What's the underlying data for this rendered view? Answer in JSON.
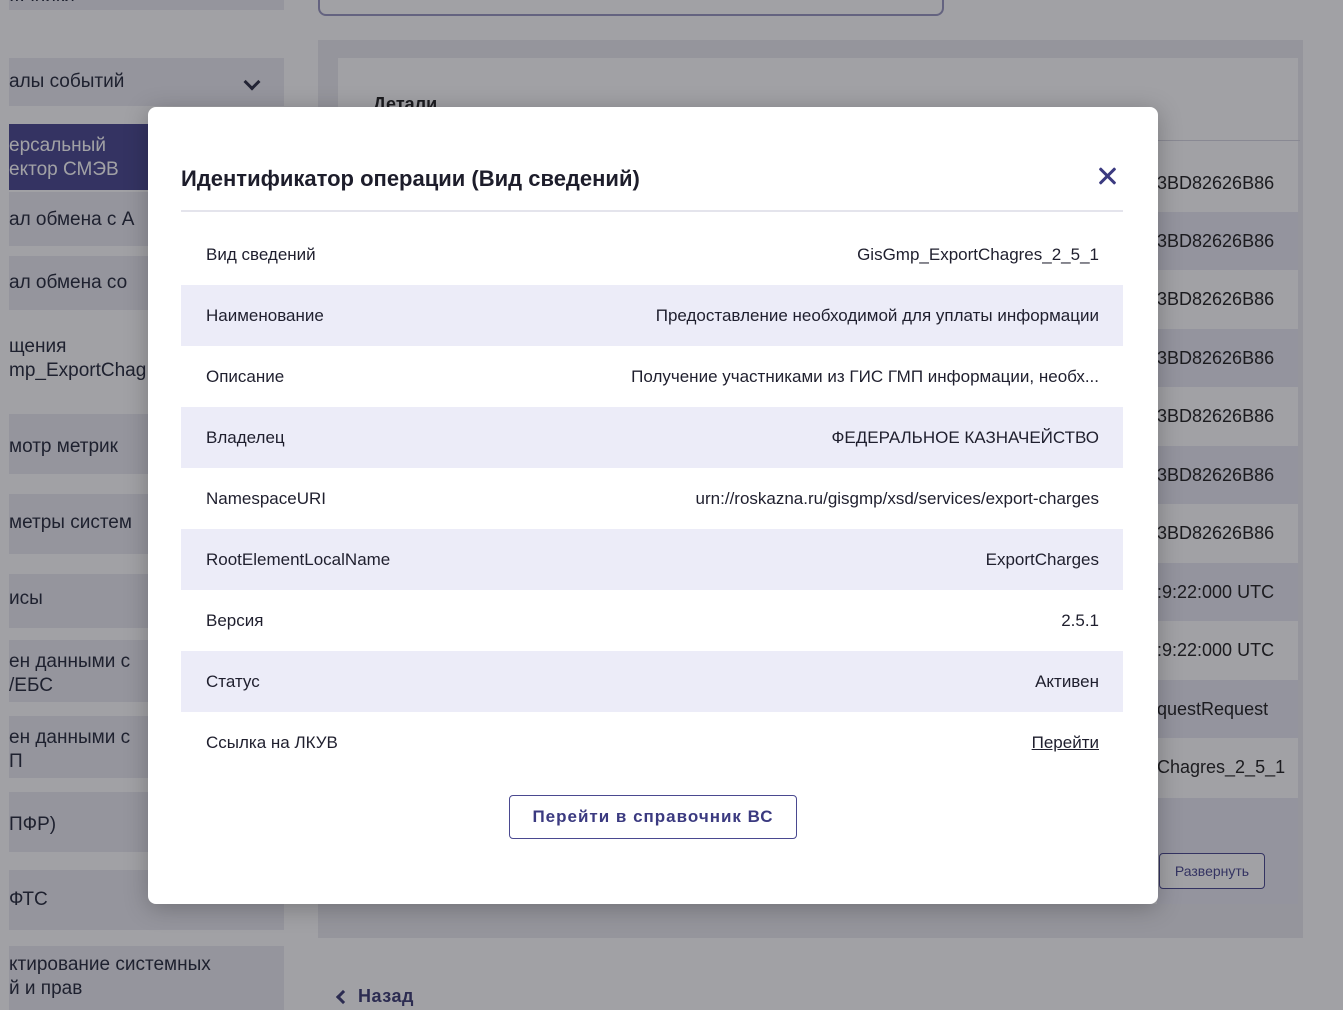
{
  "sidebar": {
    "items": [
      {
        "label": "...чники"
      },
      {
        "label": "алы событий"
      },
      {
        "label": "ерсальный\nектор СМЭВ"
      },
      {
        "label": "ал обмена с А"
      },
      {
        "label": "ал обмена со"
      },
      {
        "label": "щения\nmp_ExportChag"
      },
      {
        "label": "мотр метрик"
      },
      {
        "label": "метры систем"
      },
      {
        "label": "исы"
      },
      {
        "label": "ен данными с\n/ЕБС"
      },
      {
        "label": "ен данными с\nП"
      },
      {
        "label": "ПФР)"
      },
      {
        "label": "ФТС"
      },
      {
        "label": "ктирование системных\nй и прав"
      }
    ]
  },
  "background": {
    "details_title": "Детали",
    "right_rows": [
      "3BD82626B86",
      "3BD82626B86",
      "3BD82626B86",
      "3BD82626B86",
      "3BD82626B86",
      "3BD82626B86",
      "3BD82626B86",
      ":9:22:000 UTC",
      ":9:22:000 UTC",
      "questRequest",
      "Chagres_2_5_1"
    ],
    "expand_label": "Развернуть",
    "back_label": "Назад"
  },
  "modal": {
    "title": "Идентификатор операции (Вид сведений)",
    "rows": [
      {
        "key": "Вид сведений",
        "value": "GisGmp_ExportChagres_2_5_1"
      },
      {
        "key": "Наименование",
        "value": "Предоставление необходимой для уплаты информации"
      },
      {
        "key": "Описание",
        "value": "Получение участниками из ГИС ГМП информации, необх..."
      },
      {
        "key": "Владелец",
        "value": "ФЕДЕРАЛЬНОЕ КАЗНАЧЕЙСТВО"
      },
      {
        "key": "NamespaceURI",
        "value": "urn://roskazna.ru/gisgmp/xsd/services/export-charges"
      },
      {
        "key": "RootElementLocalName",
        "value": "ExportCharges"
      },
      {
        "key": "Версия",
        "value": "2.5.1"
      },
      {
        "key": "Статус",
        "value": "Активен"
      },
      {
        "key": "Ссылка на ЛКУВ",
        "value": "Перейти"
      }
    ],
    "directory_button": "Перейти в справочник ВС"
  },
  "colors": {
    "accent": "#4a4990",
    "row_shade": "#ececf8",
    "overlay": "rgba(20,20,30,0.40)"
  }
}
